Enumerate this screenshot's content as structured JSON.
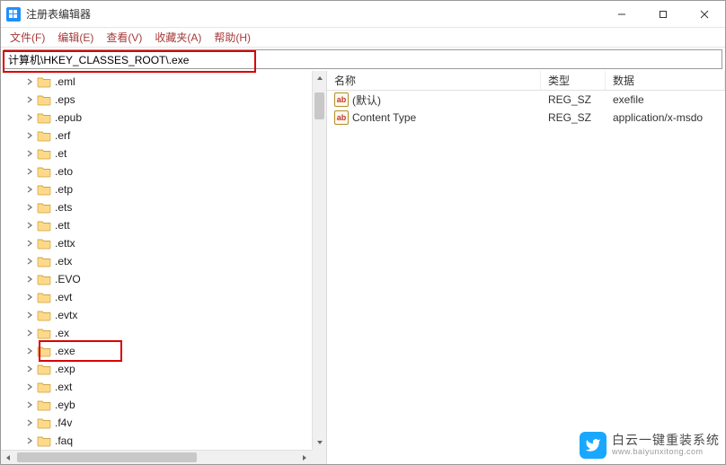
{
  "window": {
    "title": "注册表编辑器"
  },
  "menu": {
    "file": "文件(F)",
    "edit": "编辑(E)",
    "view": "查看(V)",
    "fav": "收藏夹(A)",
    "help": "帮助(H)"
  },
  "address": {
    "path": "计算机\\HKEY_CLASSES_ROOT\\.exe"
  },
  "tree": {
    "items": [
      ".eml",
      ".eps",
      ".epub",
      ".erf",
      ".et",
      ".eto",
      ".etp",
      ".ets",
      ".ett",
      ".ettx",
      ".etx",
      ".EVO",
      ".evt",
      ".evtx",
      ".ex",
      ".exe",
      ".exp",
      ".ext",
      ".eyb",
      ".f4v",
      ".faq"
    ],
    "highlight_index": 15
  },
  "list": {
    "headers": {
      "name": "名称",
      "type": "类型",
      "data": "数据"
    },
    "rows": [
      {
        "name": "(默认)",
        "type": "REG_SZ",
        "data": "exefile"
      },
      {
        "name": "Content Type",
        "type": "REG_SZ",
        "data": "application/x-msdo"
      }
    ]
  },
  "watermark": {
    "line1": "白云一键重装系统",
    "line2": "www.baiyunxitong.com"
  }
}
